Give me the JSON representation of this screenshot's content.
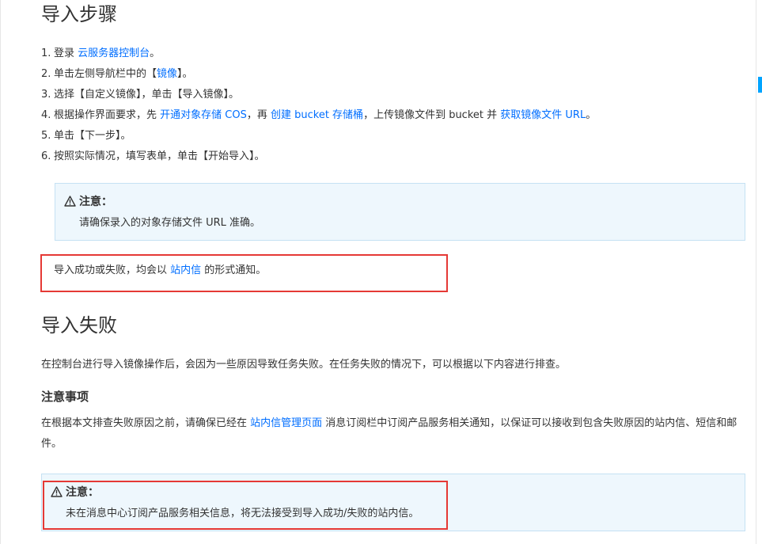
{
  "import_steps": {
    "title": "导入步骤",
    "steps": [
      {
        "num": "1.",
        "t1": "登录 ",
        "link1": "云服务器控制台",
        "t2": "。"
      },
      {
        "num": "2.",
        "t1": "单击左侧导航栏中的【",
        "link1": "镜像",
        "t2": "】。"
      },
      {
        "num": "3.",
        "t1": "选择【自定义镜像】，单击【导入镜像】。"
      },
      {
        "num": "4.",
        "t1": "根据操作界面要求，先 ",
        "link1": "开通对象存储 COS",
        "t2": "，再 ",
        "link2": "创建 bucket 存储桶",
        "t3": "，上传镜像文件到 bucket 并 ",
        "link3": "获取镜像文件 URL",
        "t4": "。"
      },
      {
        "num": "5.",
        "t1": "单击【下一步】。"
      },
      {
        "num": "6.",
        "t1": "按照实际情况，填写表单，单击【开始导入】。"
      }
    ],
    "note": {
      "title": "注意：",
      "body": "请确保录入的对象存储文件 URL 准确。"
    },
    "result_line": {
      "t1": "导入成功或失败，均会以 ",
      "link": "站内信",
      "t2": " 的形式通知。"
    }
  },
  "import_failure": {
    "title": "导入失败",
    "intro": "在控制台进行导入镜像操作后，会因为一些原因导致任务失败。在任务失败的情况下，可以根据以下内容进行排查。",
    "subtitle": "注意事项",
    "para": {
      "t1": "在根据本文排查失败原因之前，请确保已经在 ",
      "link": "站内信管理页面",
      "t2": " 消息订阅栏中订阅产品服务相关通知，以保证可以接收到包含失败原因的站内信、短信和邮件。"
    },
    "note": {
      "title": "注意：",
      "body": "未在消息中心订阅产品服务相关信息，将无法接受到导入成功/失败的站内信。"
    }
  },
  "icons": {
    "warning": "warning-triangle-icon"
  },
  "colors": {
    "link": "#006eff",
    "note_bg": "#eef7fd",
    "note_border": "#c5e1f3",
    "highlight": "#e53935",
    "text": "#333333"
  }
}
